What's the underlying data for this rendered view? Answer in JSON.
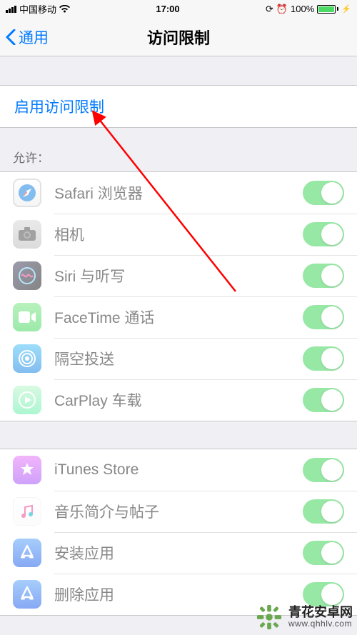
{
  "status": {
    "carrier": "中国移动",
    "time": "17:00",
    "battery_pct": "100%"
  },
  "nav": {
    "back_label": "通用",
    "title": "访问限制"
  },
  "enable": {
    "label": "启用访问限制"
  },
  "allow_header": "允许：",
  "allow": [
    {
      "icon": "safari",
      "label": "Safari 浏览器",
      "on": true
    },
    {
      "icon": "camera",
      "label": "相机",
      "on": true
    },
    {
      "icon": "siri",
      "label": "Siri 与听写",
      "on": true
    },
    {
      "icon": "facetime",
      "label": "FaceTime 通话",
      "on": true
    },
    {
      "icon": "airdrop",
      "label": "隔空投送",
      "on": true
    },
    {
      "icon": "carplay",
      "label": "CarPlay 车载",
      "on": true
    }
  ],
  "store": [
    {
      "icon": "itunes",
      "label": "iTunes Store",
      "on": true
    },
    {
      "icon": "music",
      "label": "音乐简介与帖子",
      "on": true
    },
    {
      "icon": "appstore",
      "label": "安装应用",
      "on": true
    },
    {
      "icon": "appstore",
      "label": "删除应用",
      "on": true
    }
  ],
  "watermark": {
    "title": "青花安卓网",
    "url": "www.qhhlv.com"
  }
}
